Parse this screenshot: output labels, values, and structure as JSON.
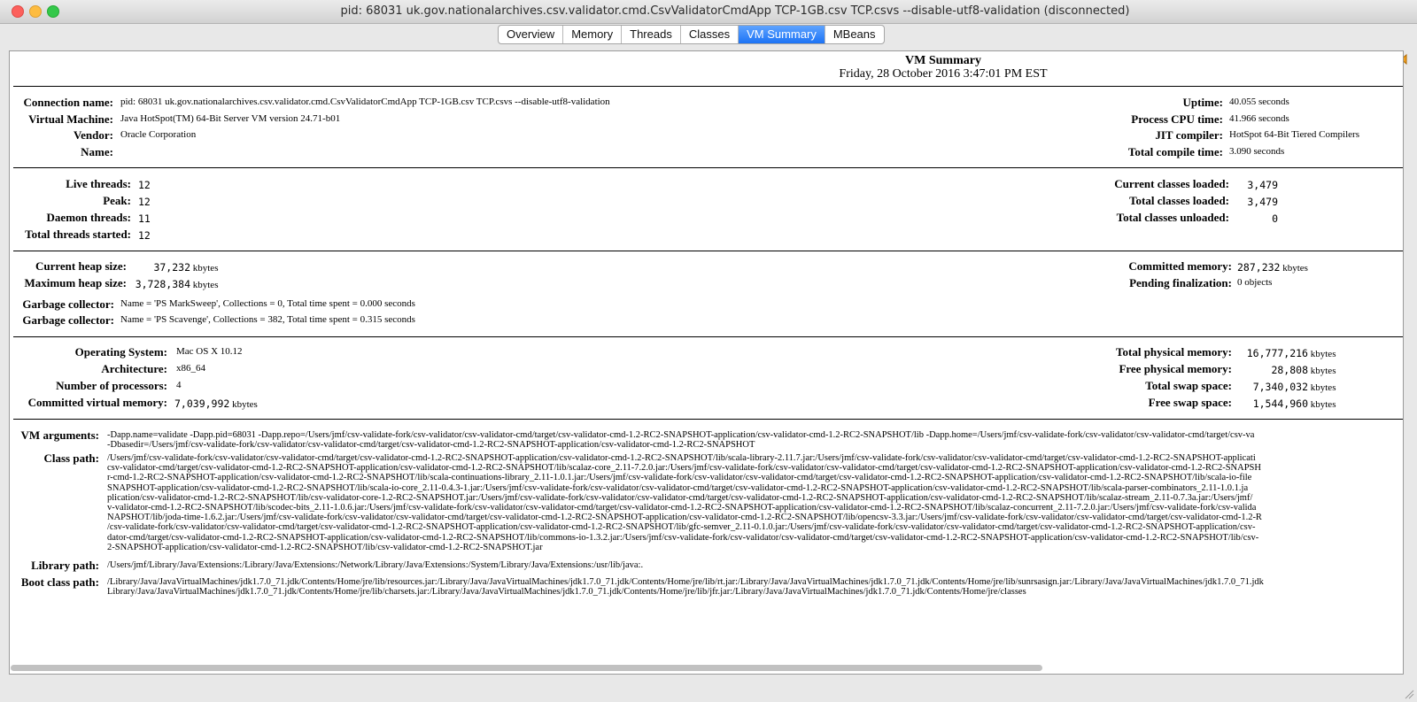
{
  "window": {
    "title": "pid: 68031 uk.gov.nationalarchives.csv.validator.cmd.CsvValidatorCmdApp TCP-1GB.csv TCP.csvs --disable-utf8-validation (disconnected)"
  },
  "tabs": [
    {
      "label": "Overview",
      "active": false
    },
    {
      "label": "Memory",
      "active": false
    },
    {
      "label": "Threads",
      "active": false
    },
    {
      "label": "Classes",
      "active": false
    },
    {
      "label": "VM Summary",
      "active": true
    },
    {
      "label": "MBeans",
      "active": false
    }
  ],
  "summary": {
    "heading": "VM Summary",
    "timestamp": "Friday, 28 October 2016 3:47:01 PM EST"
  },
  "section1": {
    "left": [
      {
        "label": "Connection name:",
        "value": "pid: 68031 uk.gov.nationalarchives.csv.validator.cmd.CsvValidatorCmdApp TCP-1GB.csv TCP.csvs --disable-utf8-validation"
      },
      {
        "label": "Virtual Machine:",
        "value": "Java HotSpot(TM) 64-Bit Server VM version 24.71-b01"
      },
      {
        "label": "Vendor:",
        "value": "Oracle Corporation"
      },
      {
        "label": "Name:",
        "value": ""
      }
    ],
    "right": [
      {
        "label": "Uptime:",
        "value": "40.055 seconds"
      },
      {
        "label": "Process CPU time:",
        "value": "41.966 seconds"
      },
      {
        "label": "JIT compiler:",
        "value": "HotSpot 64-Bit Tiered Compilers"
      },
      {
        "label": "Total compile time:",
        "value": "3.090 seconds"
      }
    ]
  },
  "section2": {
    "left": [
      {
        "label": "Live threads:",
        "value": "12"
      },
      {
        "label": "Peak:",
        "value": "12"
      },
      {
        "label": "Daemon threads:",
        "value": "11"
      },
      {
        "label": "Total threads started:",
        "value": "12"
      }
    ],
    "right": [
      {
        "label": "Current classes loaded:",
        "value": "3,479"
      },
      {
        "label": "Total classes loaded:",
        "value": "3,479"
      },
      {
        "label": "Total classes unloaded:",
        "value": "0"
      }
    ]
  },
  "section3": {
    "left": [
      {
        "label": "Current heap size:",
        "value": "37,232",
        "unit": "kbytes"
      },
      {
        "label": "Maximum heap size:",
        "value": "3,728,384",
        "unit": "kbytes"
      }
    ],
    "gc": [
      {
        "label": "Garbage collector:",
        "value": "Name = 'PS MarkSweep', Collections = 0, Total time spent = 0.000 seconds"
      },
      {
        "label": "Garbage collector:",
        "value": "Name = 'PS Scavenge', Collections = 382, Total time spent = 0.315 seconds"
      }
    ],
    "right": [
      {
        "label": "Committed memory:",
        "value": "287,232",
        "unit": "kbytes"
      },
      {
        "label": "Pending finalization:",
        "value": "0 objects"
      }
    ]
  },
  "section4": {
    "left": [
      {
        "label": "Operating System:",
        "value": "Mac OS X 10.12",
        "unit": ""
      },
      {
        "label": "Architecture:",
        "value": "x86_64",
        "unit": ""
      },
      {
        "label": "Number of processors:",
        "value": "4",
        "unit": ""
      },
      {
        "label": "Committed virtual memory:",
        "value": "7,039,992",
        "unit": "kbytes"
      }
    ],
    "right": [
      {
        "label": "Total physical memory:",
        "value": "16,777,216",
        "unit": "kbytes"
      },
      {
        "label": "Free physical memory:",
        "value": "28,808",
        "unit": "kbytes"
      },
      {
        "label": "Total swap space:",
        "value": "7,340,032",
        "unit": "kbytes"
      },
      {
        "label": "Free swap space:",
        "value": "1,544,960",
        "unit": "kbytes"
      }
    ]
  },
  "section5": {
    "vm_arguments": {
      "label": "VM arguments:",
      "value": "-Dapp.name=validate -Dapp.pid=68031 -Dapp.repo=/Users/jmf/csv-validate-fork/csv-validator/csv-validator-cmd/target/csv-validator-cmd-1.2-RC2-SNAPSHOT-application/csv-validator-cmd-1.2-RC2-SNAPSHOT/lib -Dapp.home=/Users/jmf/csv-validate-fork/csv-validator/csv-validator-cmd/target/csv-va\n-Dbasedir=/Users/jmf/csv-validate-fork/csv-validator/csv-validator-cmd/target/csv-validator-cmd-1.2-RC2-SNAPSHOT-application/csv-validator-cmd-1.2-RC2-SNAPSHOT"
    },
    "class_path": {
      "label": "Class path:",
      "value": "/Users/jmf/csv-validate-fork/csv-validator/csv-validator-cmd/target/csv-validator-cmd-1.2-RC2-SNAPSHOT-application/csv-validator-cmd-1.2-RC2-SNAPSHOT/lib/scala-library-2.11.7.jar:/Users/jmf/csv-validate-fork/csv-validator/csv-validator-cmd/target/csv-validator-cmd-1.2-RC2-SNAPSHOT-applicati\ncsv-validator-cmd/target/csv-validator-cmd-1.2-RC2-SNAPSHOT-application/csv-validator-cmd-1.2-RC2-SNAPSHOT/lib/scalaz-core_2.11-7.2.0.jar:/Users/jmf/csv-validate-fork/csv-validator/csv-validator-cmd/target/csv-validator-cmd-1.2-RC2-SNAPSHOT-application/csv-validator-cmd-1.2-RC2-SNAPSH\nr-cmd-1.2-RC2-SNAPSHOT-application/csv-validator-cmd-1.2-RC2-SNAPSHOT/lib/scala-continuations-library_2.11-1.0.1.jar:/Users/jmf/csv-validate-fork/csv-validator/csv-validator-cmd/target/csv-validator-cmd-1.2-RC2-SNAPSHOT-application/csv-validator-cmd-1.2-RC2-SNAPSHOT/lib/scala-io-file\nSNAPSHOT-application/csv-validator-cmd-1.2-RC2-SNAPSHOT/lib/scala-io-core_2.11-0.4.3-1.jar:/Users/jmf/csv-validate-fork/csv-validator/csv-validator-cmd/target/csv-validator-cmd-1.2-RC2-SNAPSHOT-application/csv-validator-cmd-1.2-RC2-SNAPSHOT/lib/scala-parser-combinators_2.11-1.0.1.ja\nplication/csv-validator-cmd-1.2-RC2-SNAPSHOT/lib/csv-validator-core-1.2-RC2-SNAPSHOT.jar:/Users/jmf/csv-validate-fork/csv-validator/csv-validator-cmd/target/csv-validator-cmd-1.2-RC2-SNAPSHOT-application/csv-validator-cmd-1.2-RC2-SNAPSHOT/lib/scalaz-stream_2.11-0.7.3a.jar:/Users/jmf/\nv-validator-cmd-1.2-RC2-SNAPSHOT/lib/scodec-bits_2.11-1.0.6.jar:/Users/jmf/csv-validate-fork/csv-validator/csv-validator-cmd/target/csv-validator-cmd-1.2-RC2-SNAPSHOT-application/csv-validator-cmd-1.2-RC2-SNAPSHOT/lib/scalaz-concurrent_2.11-7.2.0.jar:/Users/jmf/csv-validate-fork/csv-valida\nNAPSHOT/lib/joda-time-1.6.2.jar:/Users/jmf/csv-validate-fork/csv-validator/csv-validator-cmd/target/csv-validator-cmd-1.2-RC2-SNAPSHOT-application/csv-validator-cmd-1.2-RC2-SNAPSHOT/lib/opencsv-3.3.jar:/Users/jmf/csv-validate-fork/csv-validator/csv-validator-cmd/target/csv-validator-cmd-1.2-R\n/csv-validate-fork/csv-validator/csv-validator-cmd/target/csv-validator-cmd-1.2-RC2-SNAPSHOT-application/csv-validator-cmd-1.2-RC2-SNAPSHOT/lib/gfc-semver_2.11-0.1.0.jar:/Users/jmf/csv-validate-fork/csv-validator/csv-validator-cmd/target/csv-validator-cmd-1.2-RC2-SNAPSHOT-application/csv-\ndator-cmd/target/csv-validator-cmd-1.2-RC2-SNAPSHOT-application/csv-validator-cmd-1.2-RC2-SNAPSHOT/lib/commons-io-1.3.2.jar:/Users/jmf/csv-validate-fork/csv-validator/csv-validator-cmd/target/csv-validator-cmd-1.2-RC2-SNAPSHOT-application/csv-validator-cmd-1.2-RC2-SNAPSHOT/lib/csv-\n2-SNAPSHOT-application/csv-validator-cmd-1.2-RC2-SNAPSHOT/lib/csv-validator-cmd-1.2-RC2-SNAPSHOT.jar"
    },
    "library_path": {
      "label": "Library path:",
      "value": "/Users/jmf/Library/Java/Extensions:/Library/Java/Extensions:/Network/Library/Java/Extensions:/System/Library/Java/Extensions:/usr/lib/java:."
    },
    "boot_class_path": {
      "label": "Boot class path:",
      "value": "/Library/Java/JavaVirtualMachines/jdk1.7.0_71.jdk/Contents/Home/jre/lib/resources.jar:/Library/Java/JavaVirtualMachines/jdk1.7.0_71.jdk/Contents/Home/jre/lib/rt.jar:/Library/Java/JavaVirtualMachines/jdk1.7.0_71.jdk/Contents/Home/jre/lib/sunrsasign.jar:/Library/Java/JavaVirtualMachines/jdk1.7.0_71.jdk\nLibrary/Java/JavaVirtualMachines/jdk1.7.0_71.jdk/Contents/Home/jre/lib/charsets.jar:/Library/Java/JavaVirtualMachines/jdk1.7.0_71.jdk/Contents/Home/jre/lib/jfr.jar:/Library/Java/JavaVirtualMachines/jdk1.7.0_71.jdk/Contents/Home/jre/classes"
    }
  }
}
